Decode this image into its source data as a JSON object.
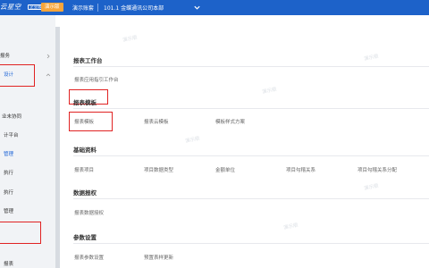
{
  "header": {
    "logo": "云星空",
    "logo_badge": "企业版",
    "trial_badge": "演示版",
    "account": "演示账套",
    "org": "101.1 金蝶通讯公司本部"
  },
  "sidebar": {
    "items": [
      {
        "label": "报务"
      },
      {
        "label": "设计"
      },
      {
        "label": "业未协同"
      },
      {
        "label": "计平台"
      },
      {
        "label": "管理"
      },
      {
        "label": "执行"
      },
      {
        "label": "执行"
      },
      {
        "label": "管理"
      },
      {
        "label": ""
      },
      {
        "label": "报表"
      }
    ]
  },
  "sections": [
    {
      "title": "报表工作台",
      "links": [
        "报表应用指引工作台"
      ]
    },
    {
      "title": "报表模板",
      "links": [
        "报表模板",
        "报表云模板",
        "模板样式方案"
      ]
    },
    {
      "title": "基础资料",
      "links": [
        "报表项目",
        "项目数据类型",
        "金额单位",
        "项目勾稽关系",
        "项目勾稽关系分配"
      ]
    },
    {
      "title": "数据报权",
      "links": [
        "报表数据授权"
      ]
    },
    {
      "title": "参数设置",
      "links": [
        "报表参数设置",
        "预置表样更新"
      ]
    }
  ],
  "watermark": "演示版",
  "colors": {
    "header_bg": "#1d62c9",
    "trial_badge": "#f7a53b",
    "highlight": "#e02222",
    "sidebar_bg": "#f1f3f6"
  }
}
